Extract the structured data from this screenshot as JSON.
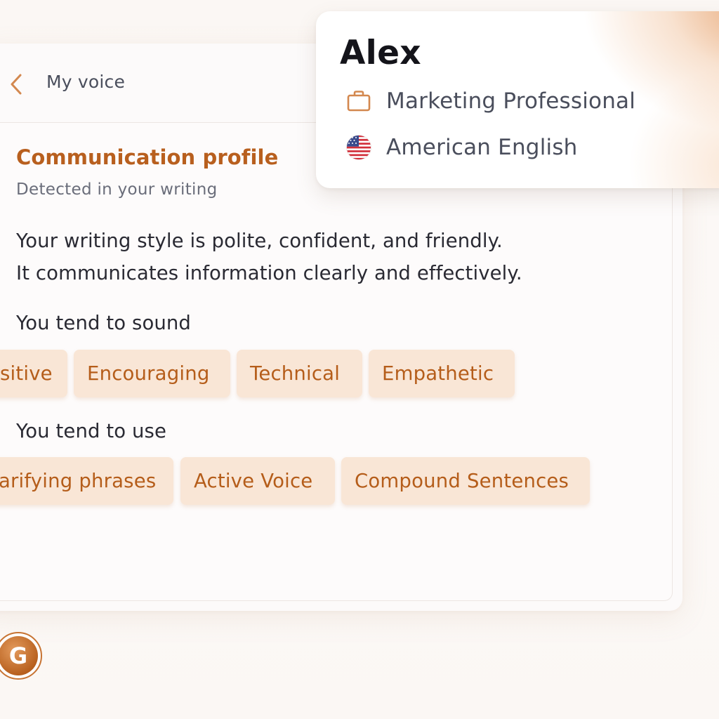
{
  "nav": {
    "back_icon": "chevron-left-icon",
    "title": "My voice"
  },
  "profile_card": {
    "name": "Alex",
    "role_icon": "briefcase-icon",
    "role": "Marketing Professional",
    "language_icon": "us-flag-icon",
    "language": "American English"
  },
  "communication_profile": {
    "title": "Communication profile",
    "subtitle": "Detected in your writing",
    "summary_line1": "Your writing style is polite, confident, and friendly.",
    "summary_line2": "It communicates information clearly and effectively.",
    "sound_label": "You tend to sound",
    "sound_tags": [
      "sitive",
      "Encouraging",
      "Technical",
      "Empathetic"
    ],
    "use_label": "You tend to use",
    "use_tags": [
      "arifying phrases",
      "Active Voice",
      "Compound Sentences"
    ]
  },
  "logo": {
    "icon": "grammarly-g-logo-icon",
    "letter": "G"
  },
  "colors": {
    "accent": "#b85f1e",
    "chip_background": "#f9e6d6",
    "chip_text": "#b55d1a",
    "glow": "#e29458"
  }
}
